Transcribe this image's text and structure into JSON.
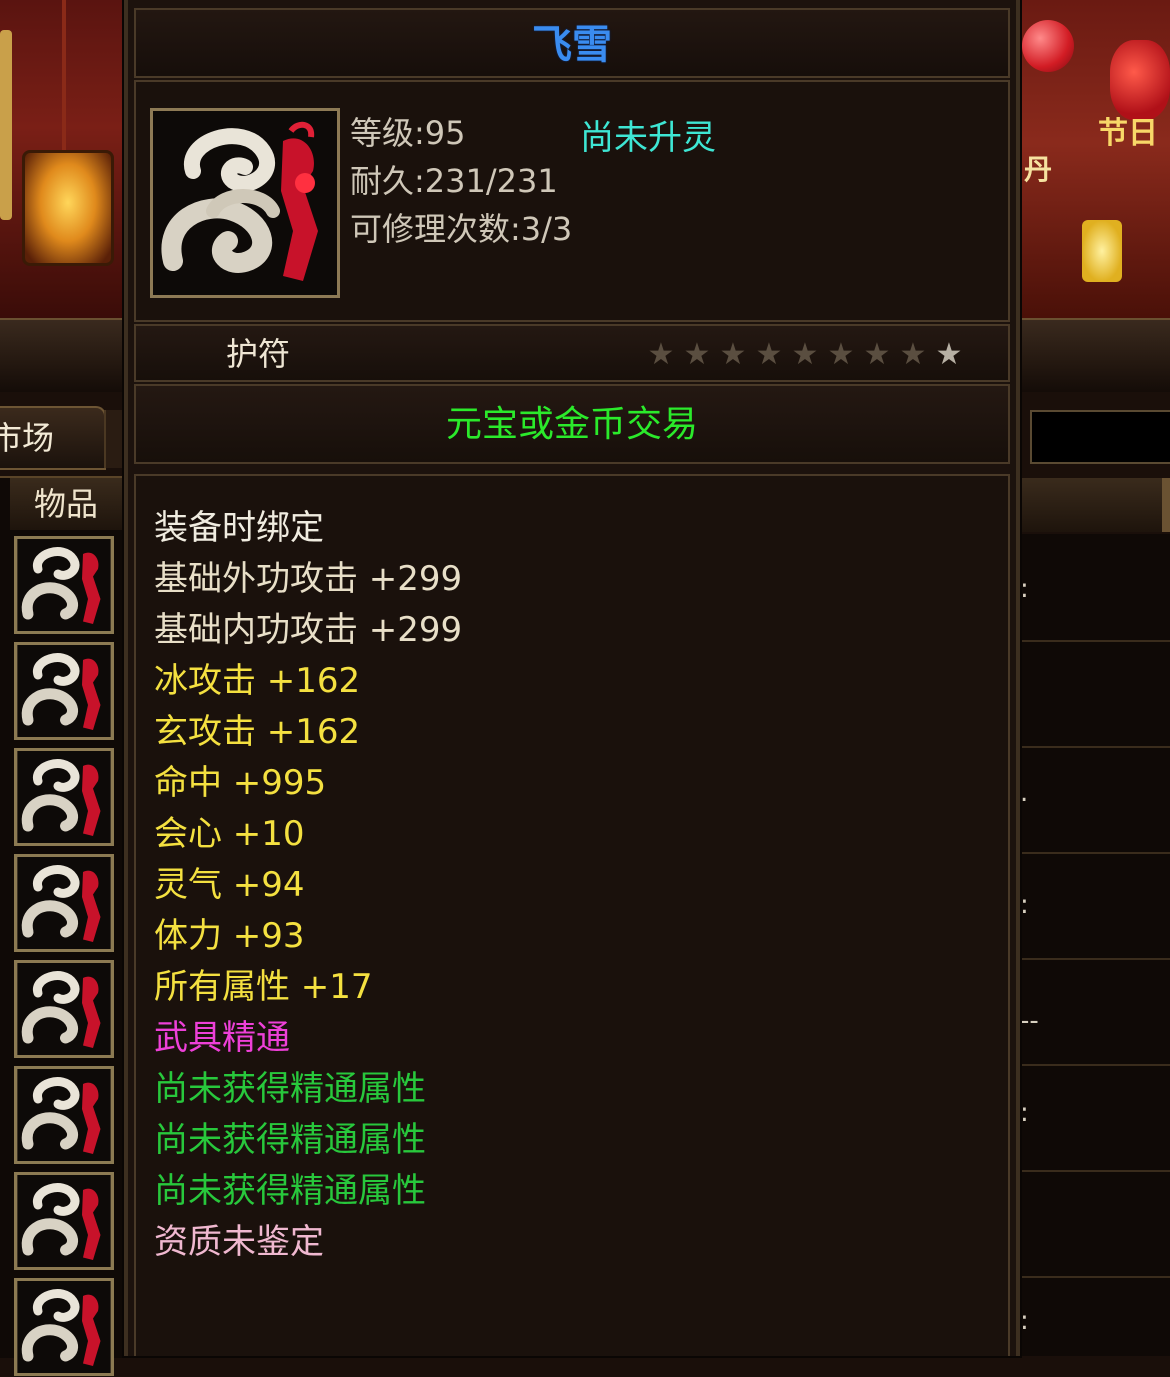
{
  "background": {
    "left_tab_label": "市场",
    "left_list_header": "物品",
    "festival_text_a": "节日",
    "festival_text_b": "丹",
    "right_row_glyphs": [
      ":",
      ".",
      ":",
      "--",
      ":",
      ":"
    ]
  },
  "tooltip": {
    "item_name": "飞雪",
    "info": {
      "level": "等级:95",
      "durability": "耐久:231/231",
      "repairs": "可修理次数:3/3",
      "spirit_status": "尚未升灵"
    },
    "item_type": "护符",
    "star_rating": {
      "lit": 1,
      "total": 9
    },
    "trade_rule": "元宝或金币交易",
    "attributes": [
      {
        "text": "装备时绑定",
        "color": "#f0ece0"
      },
      {
        "text": "基础外功攻击  +299",
        "color": "#e8dfc8"
      },
      {
        "text": "基础内功攻击  +299",
        "color": "#e8dfc8"
      },
      {
        "text": "冰攻击  +162",
        "color": "#f4e040"
      },
      {
        "text": "玄攻击  +162",
        "color": "#f4e040"
      },
      {
        "text": "命中  +995",
        "color": "#f4e040"
      },
      {
        "text": "会心  +10",
        "color": "#f4e040"
      },
      {
        "text": "灵气  +94",
        "color": "#f4e040"
      },
      {
        "text": "体力  +93",
        "color": "#f4e040"
      },
      {
        "text": "所有属性  +17",
        "color": "#f4e040"
      },
      {
        "text": "武具精通",
        "color": "#ee40d8"
      },
      {
        "text": "尚未获得精通属性",
        "color": "#28c83c"
      },
      {
        "text": "尚未获得精通属性",
        "color": "#28c83c"
      },
      {
        "text": "尚未获得精通属性",
        "color": "#28c83c"
      },
      {
        "text": "资质未鉴定",
        "color": "#f0b8d0"
      }
    ]
  },
  "icons": {
    "item_icon": "amulet-icon",
    "star_icon": "star-icon"
  }
}
